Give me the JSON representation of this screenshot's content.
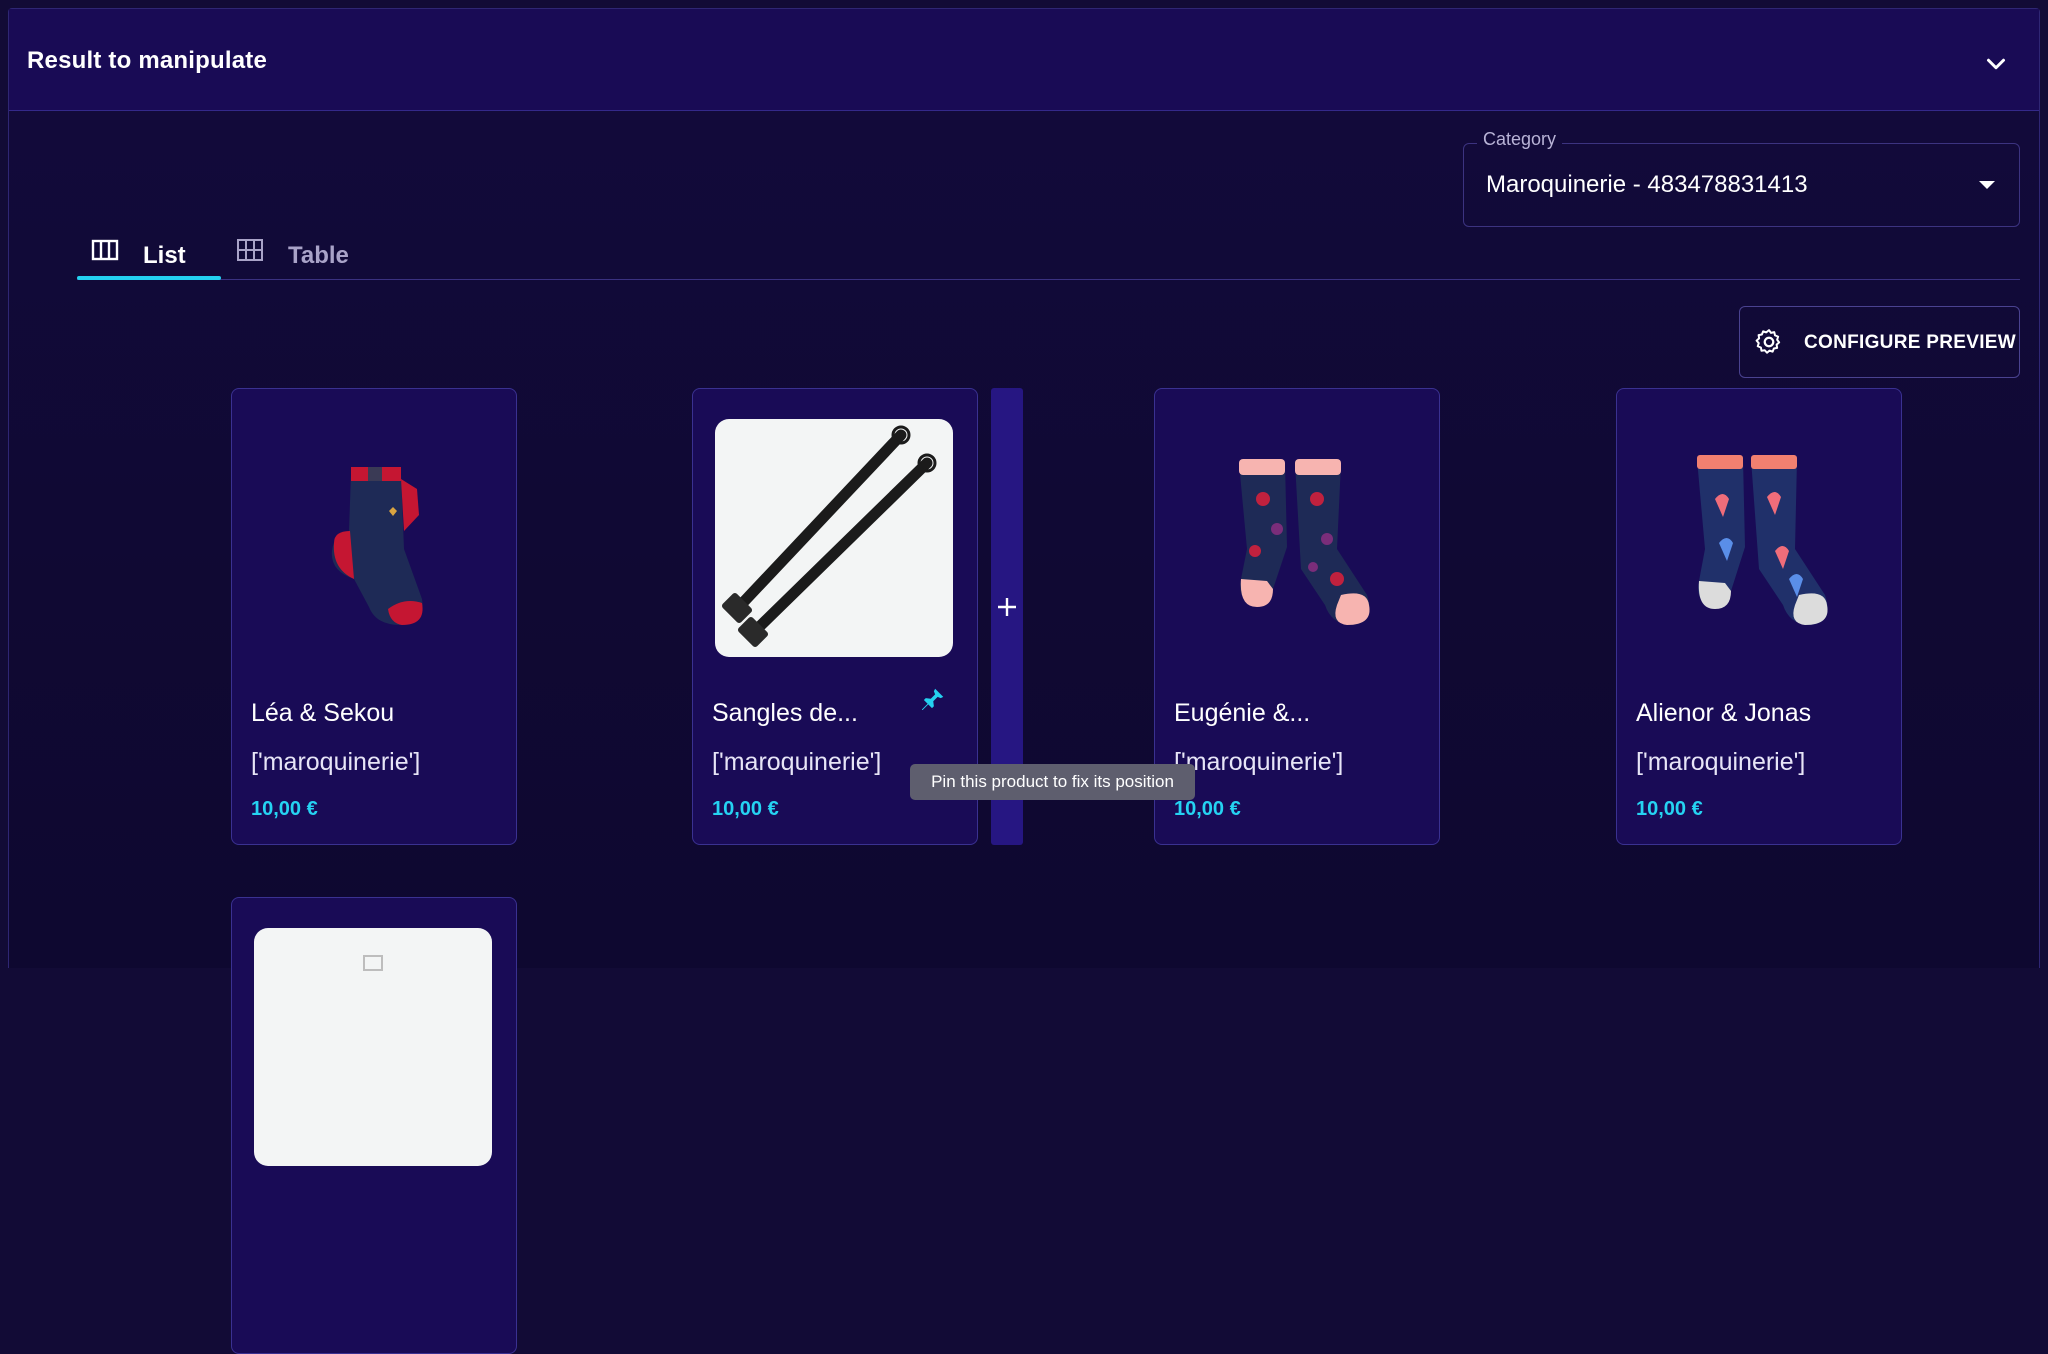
{
  "panel": {
    "title": "Result to manipulate"
  },
  "category": {
    "label": "Category",
    "value": "Maroquinerie - 483478831413"
  },
  "tabs": [
    {
      "label": "List",
      "icon": "columns-icon",
      "active": true
    },
    {
      "label": "Table",
      "icon": "grid-icon",
      "active": false
    }
  ],
  "configure_button": {
    "label": "CONFIGURE PREVIEW",
    "icon": "gear-icon"
  },
  "products": [
    {
      "name": "Léa & Sekou",
      "category": "['maroquinerie']",
      "price": "10,00 €"
    },
    {
      "name": "Sangles de...",
      "category": "['maroquinerie']",
      "price": "10,00 €"
    },
    {
      "name": "Eugénie &...",
      "category": "['maroquinerie']",
      "price": "10,00 €"
    },
    {
      "name": "Alienor & Jonas",
      "category": "['maroquinerie']",
      "price": "10,00 €"
    },
    {
      "name": "",
      "category": "",
      "price": ""
    }
  ],
  "tooltip": "Pin this product to fix its position",
  "colors": {
    "accent": "#24d1f0",
    "card_bg": "#190b56",
    "page_bg": "#120b36"
  }
}
